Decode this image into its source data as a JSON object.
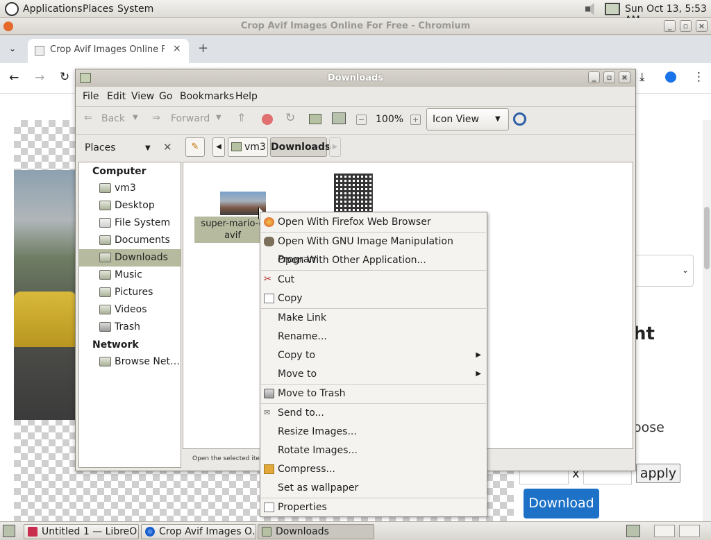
{
  "panel": {
    "menus": [
      "Applications",
      "Places",
      "System"
    ],
    "clock": "Sun Oct 13,  5:53 AM"
  },
  "browser": {
    "window_title": "Crop Avif Images Online For Free - Chromium",
    "tab_title": "Crop Avif Images Online For",
    "page": {
      "heading_fragment": "ht",
      "choose_fragment": "oose",
      "x_sep": "x",
      "apply_label": "apply",
      "download_label": "Download"
    }
  },
  "file_manager": {
    "title": "Downloads",
    "menu": [
      "File",
      "Edit",
      "View",
      "Go",
      "Bookmarks",
      "Help"
    ],
    "toolbar": {
      "back": "Back",
      "forward": "Forward",
      "zoom": "100%",
      "view_mode": "Icon View"
    },
    "sidebar_mode": "Places",
    "path": [
      "vm3",
      "Downloads"
    ],
    "sidebar": {
      "computer_header": "Computer",
      "computer_items": [
        "vm3",
        "Desktop",
        "File System",
        "Documents",
        "Downloads",
        "Music",
        "Pictures",
        "Videos",
        "Trash"
      ],
      "network_header": "Network",
      "network_items": [
        "Browse Net…"
      ]
    },
    "files": [
      {
        "name_line1": "super-mario-o",
        "name_line2": "avif"
      }
    ],
    "status": "Open the selected item i"
  },
  "context_menu": {
    "items": [
      {
        "label": "Open With Firefox Web Browser",
        "icon": "firefox-icon"
      },
      {
        "label": "Open With GNU Image Manipulation Program",
        "icon": "gimp-icon"
      },
      {
        "label": "Open With Other Application...",
        "icon": ""
      },
      {
        "label": "Cut",
        "icon": "scissors-icon"
      },
      {
        "label": "Copy",
        "icon": "copy-icon"
      },
      {
        "label": "Make Link",
        "icon": ""
      },
      {
        "label": "Rename...",
        "icon": ""
      },
      {
        "label": "Copy to",
        "icon": "",
        "submenu": true
      },
      {
        "label": "Move to",
        "icon": "",
        "submenu": true
      },
      {
        "label": "Move to Trash",
        "icon": "trash-icon"
      },
      {
        "label": "Send to...",
        "icon": "send-icon"
      },
      {
        "label": "Resize Images...",
        "icon": ""
      },
      {
        "label": "Rotate Images...",
        "icon": ""
      },
      {
        "label": "Compress...",
        "icon": "archive-icon"
      },
      {
        "label": "Set as wallpaper",
        "icon": ""
      },
      {
        "label": "Properties",
        "icon": "properties-icon"
      }
    ]
  },
  "taskbar": {
    "items": [
      "Untitled 1 — LibreO…",
      "Crop Avif Images O…",
      "Downloads"
    ]
  }
}
